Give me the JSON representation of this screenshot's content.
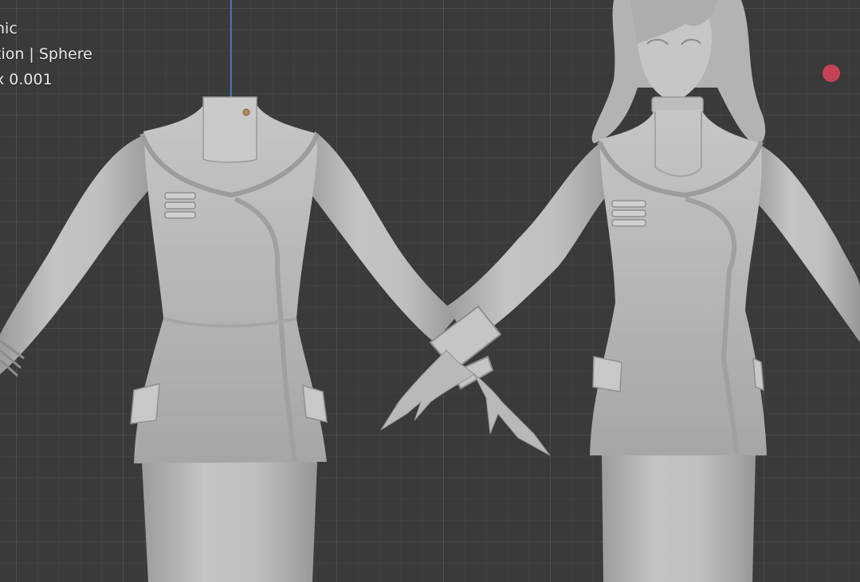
{
  "viewport": {
    "overlay_lines": [
      "hic",
      "tion | Sphere",
      "x 0.001"
    ],
    "record_indicator_color": "#c64356",
    "axis_color": "#3f6fc4",
    "background_color": "#3a3a3a"
  },
  "scene": {
    "models": [
      "jacket-only-model",
      "character-model"
    ]
  }
}
